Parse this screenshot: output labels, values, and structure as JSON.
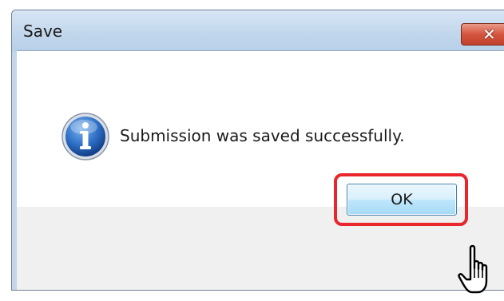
{
  "dialog": {
    "title": "Save",
    "close_label": "✕",
    "message": "Submission was saved successfully.",
    "icon": "info-icon",
    "ok_label": "OK"
  },
  "colors": {
    "highlight": "#e8262c",
    "titlebar": "#c2d7ec",
    "close_button": "#d4553f",
    "ok_button": "#bee6fd",
    "info_icon": "#1f5fb3"
  },
  "cursor": "hand-pointer-icon"
}
